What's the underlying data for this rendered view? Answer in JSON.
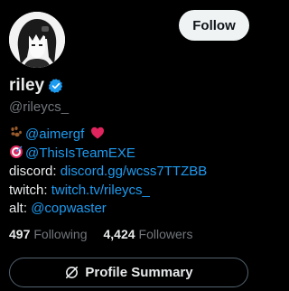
{
  "profile": {
    "display_name": "riley",
    "handle": "@rileycs_",
    "follow_label": "Follow",
    "verified": true
  },
  "bio": {
    "line1_link": "@aimergf",
    "line2_link": "@ThisIsTeamEXE",
    "line3_label": "discord:",
    "line3_link": "discord.gg/wcss7TTZBB",
    "line4_label": "twitch:",
    "line4_link": "twitch.tv/rileycs_",
    "line5_label": "alt:",
    "line5_link": "@copwaster"
  },
  "stats": {
    "following_count": "497",
    "following_label": "Following",
    "followers_count": "4,424",
    "followers_label": "Followers"
  },
  "summary": {
    "label": "Profile Summary",
    "icon": "grok-icon"
  },
  "colors": {
    "background": "#000000",
    "text": "#e7e9ea",
    "muted": "#71767b",
    "link": "#1d9bf0",
    "verified": "#1d9bf0",
    "follow_bg": "#eff3f4"
  }
}
